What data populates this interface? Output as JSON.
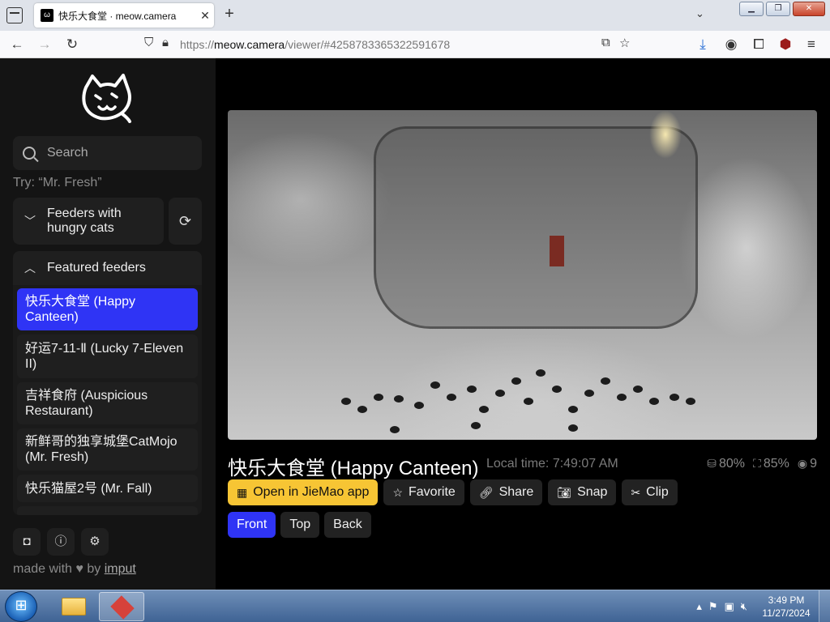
{
  "browser": {
    "tab_title": "快乐大食堂 · meow.camera",
    "url_prefix": "https://",
    "url_host": "meow.camera",
    "url_path": "/viewer/#4258783365322591678"
  },
  "sidebar": {
    "search_placeholder": "Search",
    "hint": "Try: “Mr. Fresh”",
    "feeders_hungry_label": "Feeders with hungry cats",
    "featured_label": "Featured feeders",
    "feeders": [
      {
        "label": "快乐大食堂 (Happy Canteen)",
        "active": true
      },
      {
        "label": "好运7-11-Ⅱ (Lucky 7-Eleven II)",
        "active": false
      },
      {
        "label": "吉祥食府 (Auspicious Restaurant)",
        "active": false
      },
      {
        "label": "新鲜哥的独享城堡CatMojo (Mr. Fresh)",
        "active": false
      },
      {
        "label": "快乐猫屋2号 (Mr. Fall)",
        "active": false
      }
    ],
    "made_with_prefix": "made with",
    "made_with_by": "by",
    "author": "imput"
  },
  "viewer": {
    "title": "快乐大食堂 (Happy Canteen)",
    "local_time": "Local time: 7:49:07 AM",
    "food_level": "80%",
    "battery_level": "85%",
    "viewers": "9",
    "actions": {
      "open_app": "Open in JieMao app",
      "favorite": "Favorite",
      "share": "Share",
      "snap": "Snap",
      "clip": "Clip"
    },
    "views": [
      "Front",
      "Top",
      "Back"
    ],
    "active_view": "Front"
  },
  "taskbar": {
    "time": "3:49 PM",
    "date": "11/27/2024"
  },
  "colors": {
    "accent": "#2f34f5",
    "primary_button": "#f7c534"
  }
}
